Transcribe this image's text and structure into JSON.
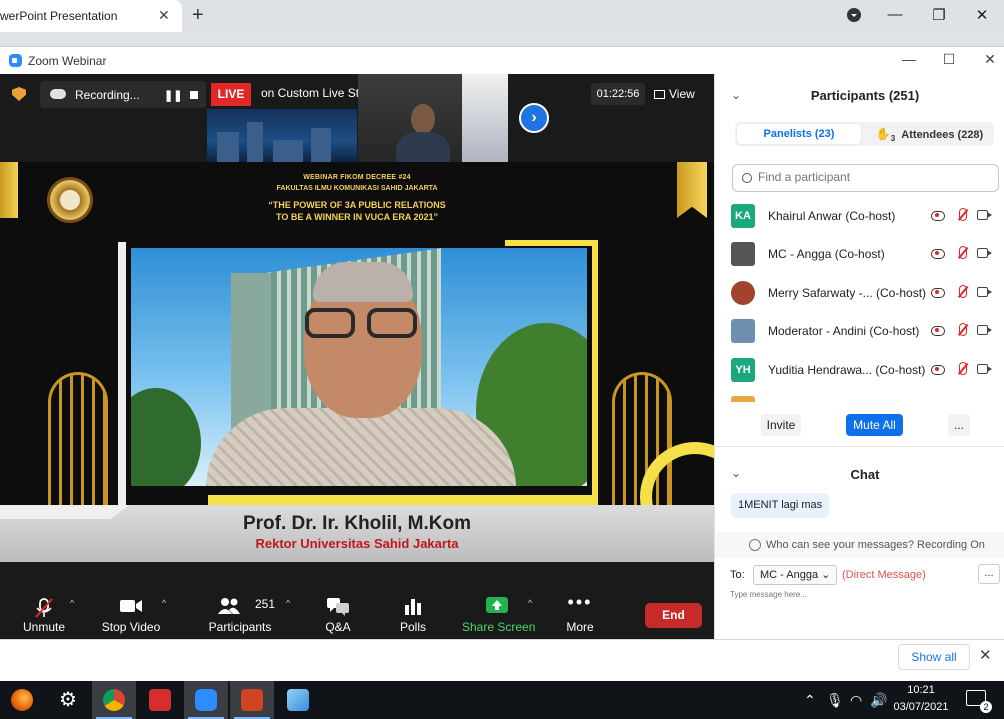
{
  "browser": {
    "tab_title": "werPoint Presentation",
    "new_tab_symbol": "+",
    "close_symbol": "✕"
  },
  "zoom": {
    "window_title": "Zoom Webinar",
    "recording_label": "Recording...",
    "live_label": "LIVE",
    "stream_label": "on Custom Live Streaming Service",
    "timer": "01:22:56",
    "view_label": "View"
  },
  "slide": {
    "line1": "WEBINAR FIKOM DECREE #24",
    "line2": "FAKULTAS ILMU KOMUNIKASI SAHID JAKARTA",
    "line3": "“THE POWER OF 3A PUBLIC RELATIONS",
    "line4": "TO BE A WINNER IN VUCA ERA 2021”",
    "speaker_name": "Prof. Dr. Ir. Kholil, M.Kom",
    "speaker_role": "Rektor Universitas Sahid Jakarta"
  },
  "toolbar": {
    "unmute": "Unmute",
    "stop_video": "Stop Video",
    "participants": "Participants",
    "participants_count": "251",
    "qa": "Q&A",
    "polls": "Polls",
    "share_screen": "Share Screen",
    "more": "More",
    "end": "End"
  },
  "participants_panel": {
    "title": "Participants (251)",
    "tab_panelists": "Panelists (23)",
    "tab_attendees": "Attendees (228)",
    "raised_hands": "3",
    "search_placeholder": "Find a participant",
    "rows": [
      {
        "initials": "KA",
        "name": "Khairul Anwar (Co-host)",
        "avatar_color": "#1aa87f"
      },
      {
        "initials": "",
        "name": "MC - Angga (Co-host)",
        "avatar_color": "#555555"
      },
      {
        "initials": "",
        "name": "Merry Safarwaty -... (Co-host)",
        "avatar_color": "#a0442e"
      },
      {
        "initials": "",
        "name": "Moderator - Andini (Co-host)",
        "avatar_color": "#6f8fb0"
      },
      {
        "initials": "YH",
        "name": "Yuditia Hendrawa... (Co-host)",
        "avatar_color": "#1aa87f"
      }
    ],
    "invite": "Invite",
    "mute_all": "Mute All",
    "more": "..."
  },
  "chat": {
    "title": "Chat",
    "message": "1MENIT lagi mas",
    "notice": "Who can see your messages? Recording On",
    "to_label": "To:",
    "recipient": "MC - Angga",
    "dm_label": "(Direct Message)",
    "menu": "...",
    "input_placeholder": "Type message here..."
  },
  "downloads": {
    "show_all": "Show all"
  },
  "taskbar": {
    "time": "10:21",
    "date": "03/07/2021",
    "notifications": "2"
  },
  "colors": {
    "zoom_blue": "#0e71eb",
    "live_red": "#e02828",
    "end_red": "#c92a2a",
    "gold": "#f3d15a"
  }
}
